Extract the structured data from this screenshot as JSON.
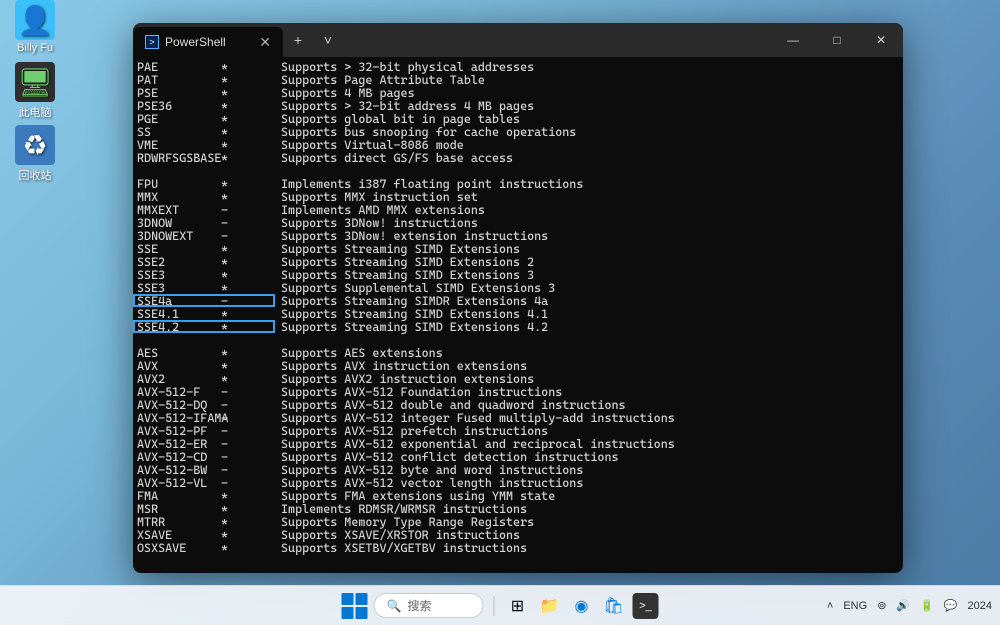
{
  "desktop": {
    "icons": [
      {
        "name": "user-folder-icon",
        "label": "Billy Fu"
      },
      {
        "name": "this-pc-icon",
        "label": "此电脑"
      },
      {
        "name": "recycle-bin-icon",
        "label": "回收站"
      }
    ]
  },
  "window": {
    "tab_title": "PowerShell",
    "controls": {
      "new_tab": "+",
      "dropdown": "˅",
      "minimize": "—",
      "maximize": "□",
      "close": "✕"
    }
  },
  "terminal": {
    "groups": [
      {
        "blank_before": false,
        "rows": [
          {
            "feat": "PAE",
            "flag": "*",
            "desc": "Supports > 32-bit physical addresses"
          },
          {
            "feat": "PAT",
            "flag": "*",
            "desc": "Supports Page Attribute Table"
          },
          {
            "feat": "PSE",
            "flag": "*",
            "desc": "Supports 4 MB pages"
          },
          {
            "feat": "PSE36",
            "flag": "*",
            "desc": "Supports > 32-bit address 4 MB pages"
          },
          {
            "feat": "PGE",
            "flag": "*",
            "desc": "Supports global bit in page tables"
          },
          {
            "feat": "SS",
            "flag": "*",
            "desc": "Supports bus snooping for cache operations"
          },
          {
            "feat": "VME",
            "flag": "*",
            "desc": "Supports Virtual-8086 mode"
          },
          {
            "feat": "RDWRFSGSBASE",
            "flag": "*",
            "desc": "Supports direct GS/FS base access"
          }
        ]
      },
      {
        "blank_before": true,
        "rows": [
          {
            "feat": "FPU",
            "flag": "*",
            "desc": "Implements i387 floating point instructions"
          },
          {
            "feat": "MMX",
            "flag": "*",
            "desc": "Supports MMX instruction set"
          },
          {
            "feat": "MMXEXT",
            "flag": "-",
            "desc": "Implements AMD MMX extensions"
          },
          {
            "feat": "3DNOW",
            "flag": "-",
            "desc": "Supports 3DNow! instructions"
          },
          {
            "feat": "3DNOWEXT",
            "flag": "-",
            "desc": "Supports 3DNow! extension instructions"
          },
          {
            "feat": "SSE",
            "flag": "*",
            "desc": "Supports Streaming SIMD Extensions"
          },
          {
            "feat": "SSE2",
            "flag": "*",
            "desc": "Supports Streaming SIMD Extensions 2"
          },
          {
            "feat": "SSE3",
            "flag": "*",
            "desc": "Supports Streaming SIMD Extensions 3"
          },
          {
            "feat": "SSE3",
            "flag": "*",
            "desc": "Supports Supplemental SIMD Extensions 3"
          },
          {
            "feat": "SSE4a",
            "flag": "-",
            "desc": "Supports Streaming SIMDR Extensions 4a",
            "hl": 1
          },
          {
            "feat": "SSE4.1",
            "flag": "*",
            "desc": "Supports Streaming SIMD Extensions 4.1"
          },
          {
            "feat": "SSE4.2",
            "flag": "*",
            "desc": "Supports Streaming SIMD Extensions 4.2",
            "hl": 2
          }
        ]
      },
      {
        "blank_before": true,
        "rows": [
          {
            "feat": "AES",
            "flag": "*",
            "desc": "Supports AES extensions"
          },
          {
            "feat": "AVX",
            "flag": "*",
            "desc": "Supports AVX instruction extensions"
          },
          {
            "feat": "AVX2",
            "flag": "*",
            "desc": "Supports AVX2 instruction extensions"
          },
          {
            "feat": "AVX-512-F",
            "flag": "-",
            "desc": "Supports AVX-512 Foundation instructions"
          },
          {
            "feat": "AVX-512-DQ",
            "flag": "-",
            "desc": "Supports AVX-512 double and quadword instructions"
          },
          {
            "feat": "AVX-512-IFAMA",
            "flag": "-",
            "desc": "Supports AVX-512 integer Fused multiply-add instructions"
          },
          {
            "feat": "AVX-512-PF",
            "flag": "-",
            "desc": "Supports AVX-512 prefetch instructions"
          },
          {
            "feat": "AVX-512-ER",
            "flag": "-",
            "desc": "Supports AVX-512 exponential and reciprocal instructions"
          },
          {
            "feat": "AVX-512-CD",
            "flag": "-",
            "desc": "Supports AVX-512 conflict detection instructions"
          },
          {
            "feat": "AVX-512-BW",
            "flag": "-",
            "desc": "Supports AVX-512 byte and word instructions"
          },
          {
            "feat": "AVX-512-VL",
            "flag": "-",
            "desc": "Supports AVX-512 vector length instructions"
          },
          {
            "feat": "FMA",
            "flag": "*",
            "desc": "Supports FMA extensions using YMM state"
          },
          {
            "feat": "MSR",
            "flag": "*",
            "desc": "Implements RDMSR/WRMSR instructions"
          },
          {
            "feat": "MTRR",
            "flag": "*",
            "desc": "Supports Memory Type Range Registers"
          },
          {
            "feat": "XSAVE",
            "flag": "*",
            "desc": "Supports XSAVE/XRSTOR instructions"
          },
          {
            "feat": "OSXSAVE",
            "flag": "*",
            "desc": "Supports XSETBV/XGETBV instructions"
          }
        ]
      }
    ]
  },
  "taskbar": {
    "search_placeholder": "搜索",
    "tray": {
      "lang": "ENG",
      "year": "2024",
      "chevron": "˄"
    }
  }
}
